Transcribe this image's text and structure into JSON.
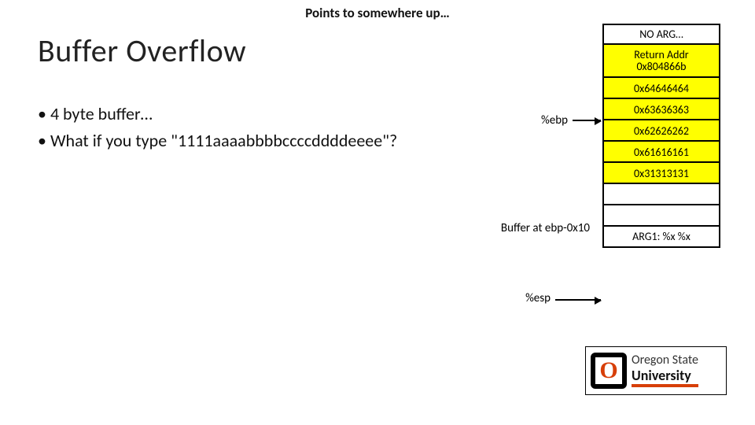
{
  "top_note": "Points to somewhere up…",
  "title": "Buffer Overflow",
  "bullets": [
    "4 byte buffer…",
    "What if you type \"1111aaaabbbbccccddddeeee\"?"
  ],
  "pointer_labels": {
    "ebp": "%ebp",
    "buffer": "Buffer at ebp-0x10",
    "esp": "%esp"
  },
  "stack": [
    {
      "lines": [
        "NO ARG…"
      ],
      "highlight": false,
      "two": false
    },
    {
      "lines": [
        "Return Addr",
        "0x804866b"
      ],
      "highlight": true,
      "two": true
    },
    {
      "lines": [
        "0x64646464"
      ],
      "highlight": true,
      "two": false
    },
    {
      "lines": [
        "0x63636363"
      ],
      "highlight": true,
      "two": false
    },
    {
      "lines": [
        "0x62626262"
      ],
      "highlight": true,
      "two": false
    },
    {
      "lines": [
        "0x61616161"
      ],
      "highlight": true,
      "two": false
    },
    {
      "lines": [
        "0x31313131"
      ],
      "highlight": true,
      "two": false
    },
    {
      "lines": [
        ""
      ],
      "highlight": false,
      "two": false
    },
    {
      "lines": [
        ""
      ],
      "highlight": false,
      "two": false
    },
    {
      "lines": [
        "ARG1: %x %x"
      ],
      "highlight": false,
      "two": false
    }
  ],
  "logo": {
    "o": "O",
    "line1": "Oregon State",
    "line2": "University"
  }
}
